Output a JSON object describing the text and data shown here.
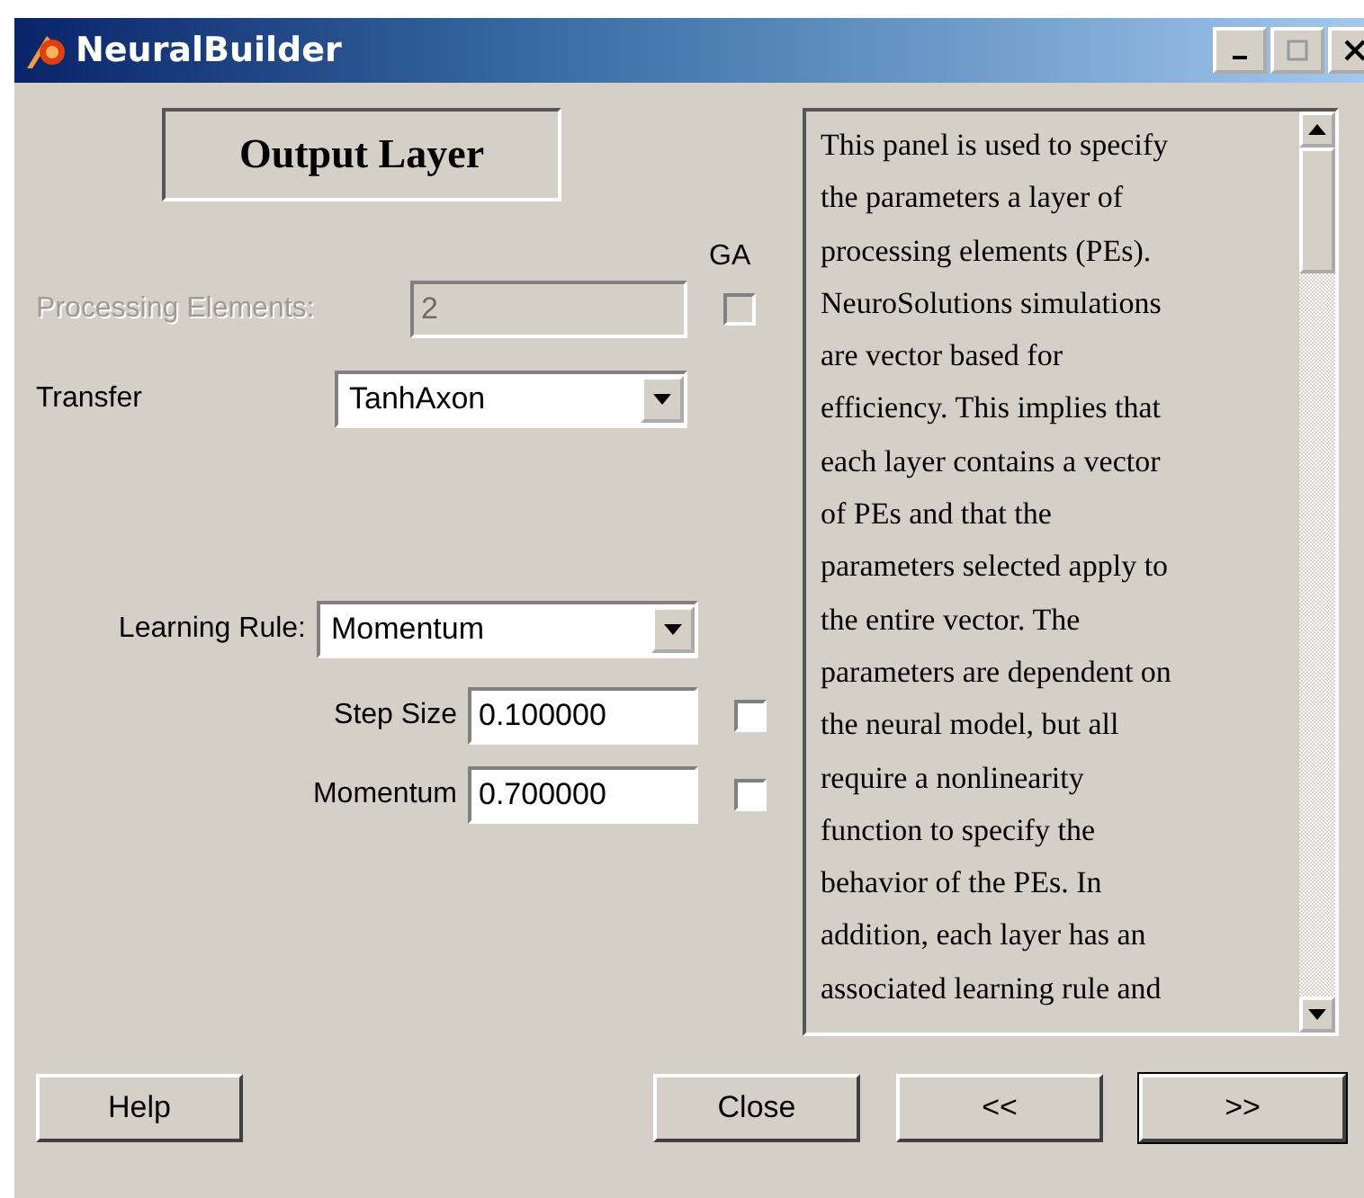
{
  "window": {
    "title": "NeuralBuilder"
  },
  "heading": "Output Layer",
  "ga_label": "GA",
  "processing_elements": {
    "label": "Processing Elements:",
    "value": "2",
    "disabled": true,
    "ga_checked": false,
    "ga_disabled": true
  },
  "transfer": {
    "label": "Transfer",
    "value": "TanhAxon"
  },
  "learning_rule": {
    "label": "Learning Rule:",
    "value": "Momentum"
  },
  "parameters": [
    {
      "label": "Step Size",
      "value": "0.100000",
      "checked": false
    },
    {
      "label": "Momentum",
      "value": "0.700000",
      "checked": false
    }
  ],
  "help_text": [
    "This panel is used to specify",
    "the parameters a layer of",
    "processing elements (PEs).",
    "NeuroSolutions simulations",
    "are vector based for",
    "efficiency. This implies that",
    "each layer contains a vector",
    "of PEs and that the",
    "parameters selected apply to",
    "the entire vector. The",
    "parameters are dependent on",
    "the neural model, but all",
    "require a nonlinearity",
    "function to specify the",
    "behavior of the PEs. In",
    "addition, each layer has an",
    "associated learning rule and"
  ],
  "buttons": [
    {
      "label": "Help",
      "default": false
    },
    {
      "label": "Close",
      "default": false
    },
    {
      "label": "<<",
      "default": false
    },
    {
      "label": ">>",
      "default": true
    }
  ]
}
